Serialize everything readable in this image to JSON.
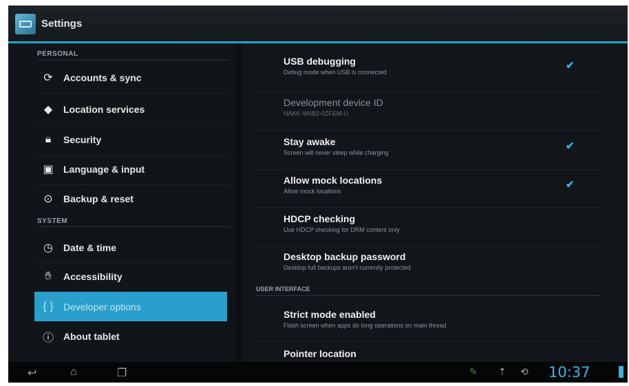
{
  "actionbar": {
    "title": "Settings",
    "icon": "settings-icon"
  },
  "left": {
    "personal_header": "PERSONAL",
    "system_header": "SYSTEM",
    "personal_items": [
      {
        "label": "Accounts & sync",
        "icon": "sync-icon"
      },
      {
        "label": "Location services",
        "icon": "location-icon"
      },
      {
        "label": "Security",
        "icon": "lock-icon"
      },
      {
        "label": "Language & input",
        "icon": "language-icon"
      },
      {
        "label": "Backup & reset",
        "icon": "backup-icon"
      }
    ],
    "system_items": [
      {
        "label": "Date & time",
        "icon": "clock-icon"
      },
      {
        "label": "Accessibility",
        "icon": "hand-icon"
      },
      {
        "label": "Developer options",
        "icon": "braces-icon",
        "selected": true
      },
      {
        "label": "About tablet",
        "icon": "info-icon"
      }
    ]
  },
  "right": {
    "prefs": [
      {
        "title": "USB debugging",
        "summary": "Debug mode when USB is connected",
        "checked": true
      },
      {
        "title": "Development device ID",
        "summary": "NAKK-W6B2-0ZFEM-U",
        "disabled": true
      },
      {
        "title": "Stay awake",
        "summary": "Screen will never sleep while charging",
        "checked": true
      },
      {
        "title": "Allow mock locations",
        "summary": "Allow mock locations",
        "checked": true
      },
      {
        "title": "HDCP checking",
        "summary": "Use HDCP checking for DRM content only"
      },
      {
        "title": "Desktop backup password",
        "summary": "Desktop full backups aren't currently protected"
      }
    ],
    "ui_header": "USER INTERFACE",
    "ui_prefs": [
      {
        "title": "Strict mode enabled",
        "summary": "Flash screen when apps do long operations on main thread"
      },
      {
        "title": "Pointer location",
        "summary": ""
      }
    ]
  },
  "navbar": {
    "back_icon": "back-icon",
    "home_icon": "home-icon",
    "recents_icon": "recents-icon",
    "time": "10:37"
  },
  "colors": {
    "accent": "#33b5e5",
    "selected": "#2a9fcc"
  }
}
